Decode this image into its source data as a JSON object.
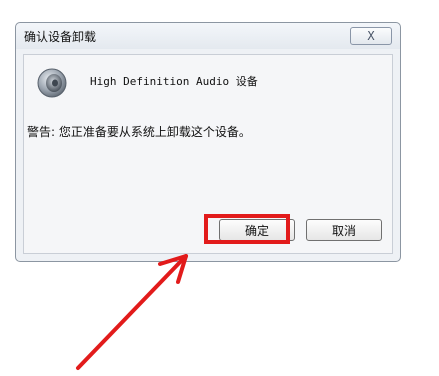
{
  "dialog": {
    "title": "确认设备卸载",
    "close_label": "X",
    "device_name": "High Definition Audio 设备",
    "warning_text": "警告: 您正准备要从系统上卸载这个设备。",
    "ok_label": "确定",
    "cancel_label": "取消"
  },
  "annotation": {
    "highlight_color": "#e21b1b",
    "arrow_color": "#e21b1b"
  }
}
